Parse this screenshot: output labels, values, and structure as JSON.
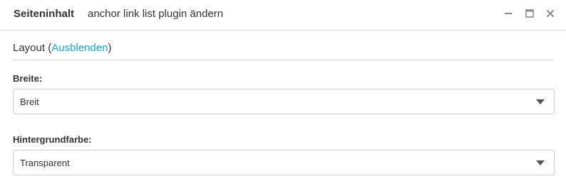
{
  "dialog": {
    "title": "Seiteninhalt",
    "subtitle": "anchor link list plugin ändern",
    "controls": {
      "minimize_icon": "minimize-icon",
      "maximize_icon": "maximize-icon",
      "close_icon": "close-icon"
    }
  },
  "section": {
    "title": "Layout",
    "open_paren": "(",
    "toggle_label": "Ausblenden",
    "close_paren": ")"
  },
  "fields": [
    {
      "label": "Breite:",
      "value": "Breit"
    },
    {
      "label": "Hintergrundfarbe:",
      "value": "Transparent"
    }
  ],
  "colors": {
    "link": "#1aa3df",
    "text": "#333333",
    "border": "#cccccc",
    "icon": "#8a8a8a"
  }
}
